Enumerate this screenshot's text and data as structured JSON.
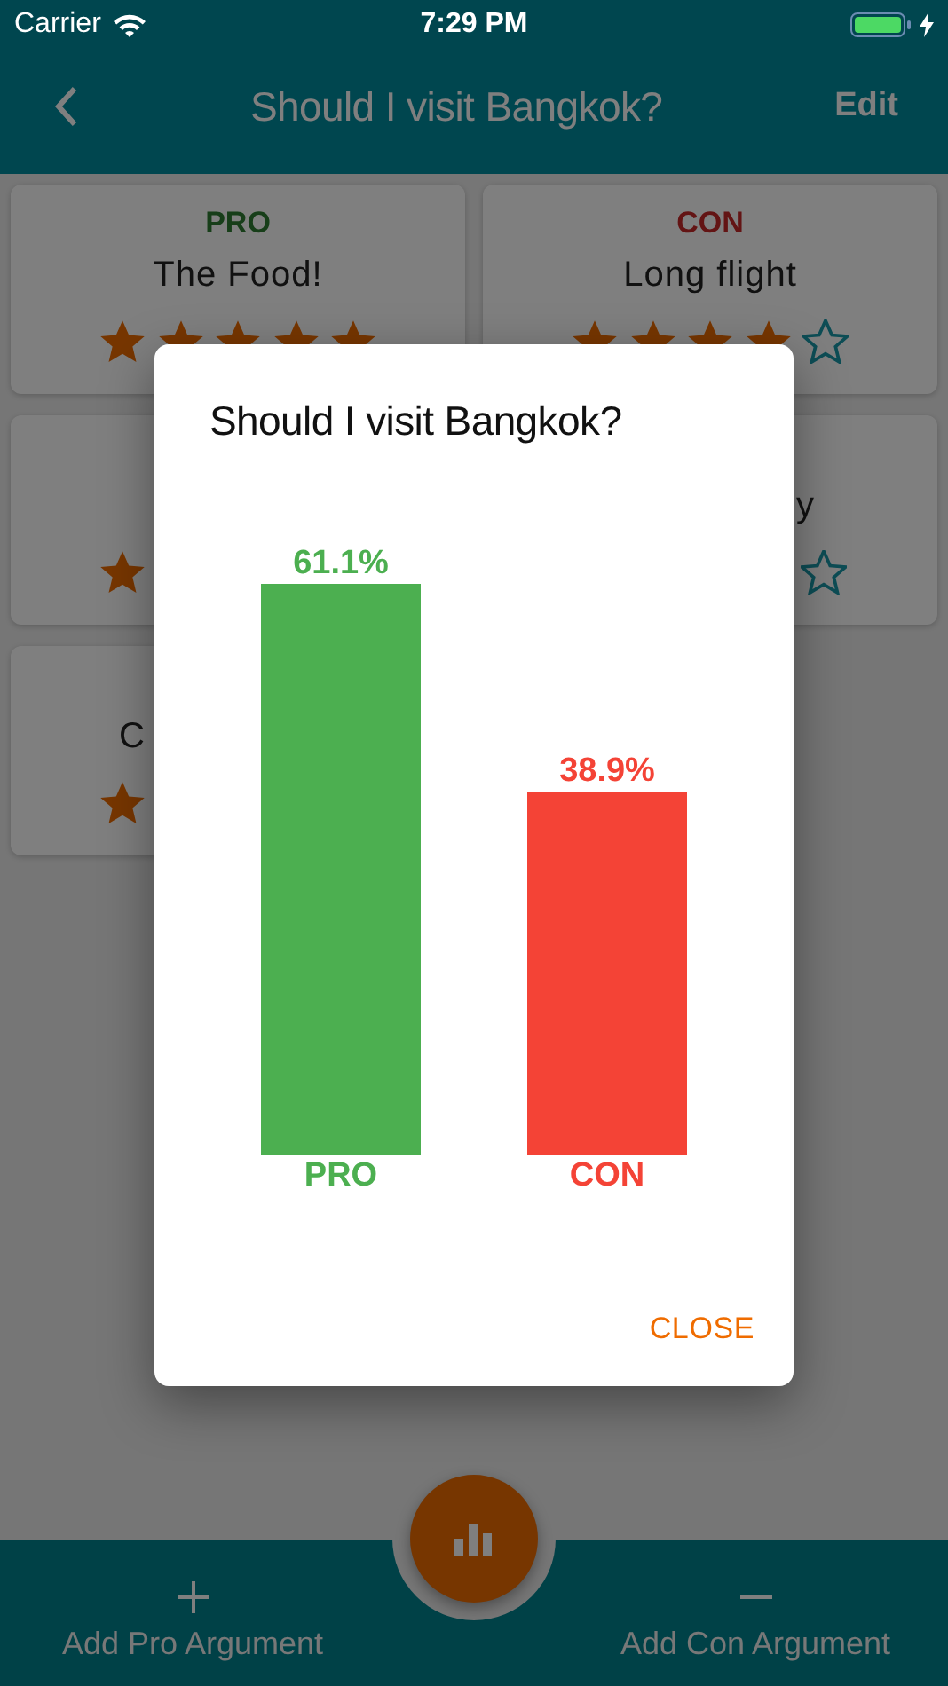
{
  "status_bar": {
    "carrier": "Carrier",
    "time": "7:29 PM"
  },
  "header": {
    "title": "Should I visit Bangkok?",
    "action": "Edit"
  },
  "cards": [
    {
      "kind": "pro",
      "tag": "PRO",
      "text": "The Food!",
      "star_icons": [
        {
          "filled": true
        },
        {
          "filled": true
        },
        {
          "filled": true
        },
        {
          "filled": true
        },
        {
          "filled": true
        }
      ]
    },
    {
      "kind": "con",
      "tag": "CON",
      "text": "Long flight",
      "star_icons": [
        {
          "filled": true
        },
        {
          "filled": true
        },
        {
          "filled": true
        },
        {
          "filled": true
        },
        {
          "filled": false
        }
      ]
    },
    {
      "star_icons": [
        {
          "filled": true
        }
      ]
    },
    {
      "text": "y",
      "star_icons": [
        {
          "filled": false
        }
      ]
    },
    {
      "text": "C",
      "star_icons": [
        {
          "filled": true
        }
      ]
    }
  ],
  "dialog": {
    "title": "Should I visit Bangkok?",
    "chart_data": {
      "type": "bar",
      "categories": [
        "PRO",
        "CON"
      ],
      "values": [
        61.1,
        38.9
      ],
      "colors": [
        "#4caf50",
        "#f44336"
      ],
      "value_labels": [
        "61.1%",
        "38.9%"
      ]
    },
    "button": "CLOSE"
  },
  "bottom_bar": {
    "items": [
      {
        "kind": "add",
        "label": "Add Pro Argument"
      },
      {
        "kind": "remove",
        "label": "Add Con Argument"
      }
    ]
  }
}
